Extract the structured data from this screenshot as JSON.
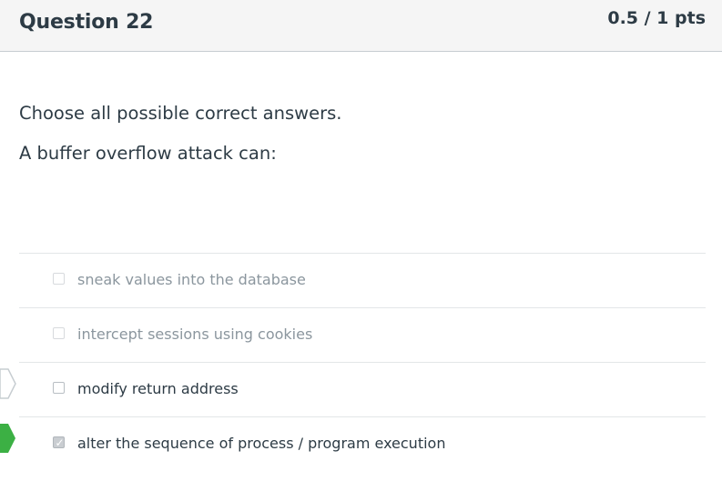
{
  "question": {
    "title": "Question 22",
    "points": "0.5 / 1 pts",
    "prompt_lines": [
      "Choose all possible correct answers.",
      "A buffer overflow attack can:"
    ]
  },
  "answers": [
    {
      "label": "sneak values into the database",
      "checked": false,
      "dimmed": true,
      "marker": "none"
    },
    {
      "label": "intercept sessions using cookies",
      "checked": false,
      "dimmed": true,
      "marker": "none"
    },
    {
      "label": "modify return address",
      "checked": false,
      "dimmed": false,
      "marker": "correct-answer-missed"
    },
    {
      "label": "alter the sequence of process / program execution",
      "checked": true,
      "dimmed": false,
      "marker": "correct"
    }
  ],
  "colors": {
    "header_bg": "#f5f5f5",
    "text": "#2d3b45",
    "correct_flag": "#3cb044",
    "missed_flag_border": "#c7cdd1"
  },
  "icons": {
    "correct_marker": "green-arrow-icon",
    "missed_marker": "outline-arrow-icon",
    "checkmark": "checkmark-icon"
  }
}
